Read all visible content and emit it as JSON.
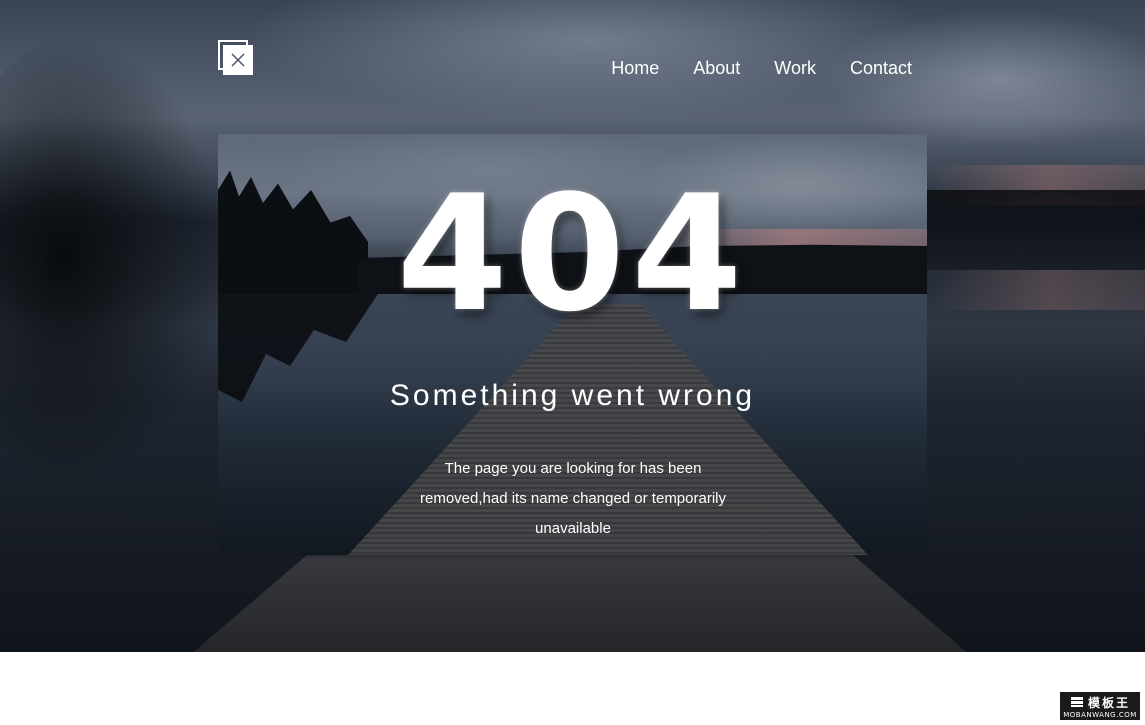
{
  "header": {
    "logo_icon": "close-icon",
    "nav": [
      {
        "label": "Home"
      },
      {
        "label": "About"
      },
      {
        "label": "Work"
      },
      {
        "label": "Contact"
      }
    ]
  },
  "error": {
    "code": "404",
    "title": "Something went wrong",
    "message": "The page you are looking for has been removed,had its name changed or temporarily unavailable"
  },
  "watermark": {
    "name": "模板王",
    "site": "MOBANWANG.COM"
  },
  "colors": {
    "text": "#ffffff",
    "page_background": "#ffffff"
  }
}
